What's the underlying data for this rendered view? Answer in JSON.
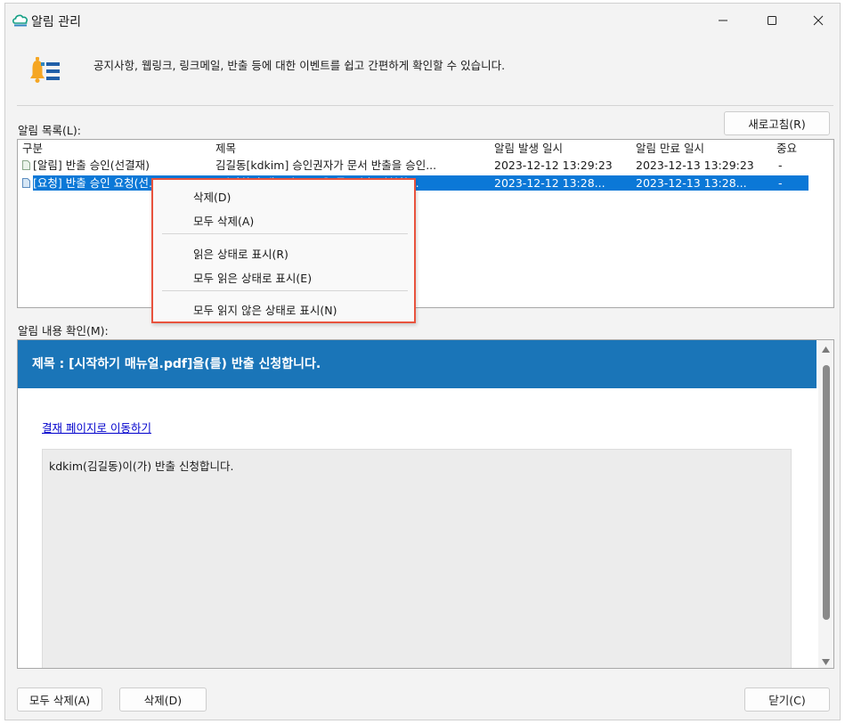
{
  "window": {
    "title": "알림 관리",
    "icons": {
      "app": "cloud-logo-icon",
      "minimize": "minimize-icon",
      "maximize": "maximize-icon",
      "close": "close-icon"
    }
  },
  "header": {
    "icon": "bell-list-icon",
    "description": "공지사항, 웹링크, 링크메일, 반출 등에 대한 이벤트를 쉽고 간편하게 확인할 수 있습니다."
  },
  "list": {
    "label": "알림 목록(L):",
    "refresh_label": "새로고침(R)",
    "columns": [
      "구분",
      "제목",
      "알림 발생 일시",
      "알림 만료 일시",
      "중요"
    ],
    "rows": [
      {
        "category": "[알림] 반출 승인(선결재)",
        "title": "김길동[kdkim] 승인권자가 문서 반출을 승인...",
        "created": "2023-12-12 13:29:23",
        "expires": "2023-12-13 13:29:23",
        "important": "-",
        "selected": false
      },
      {
        "category": "[요청] 반출 승인 요청(선...",
        "title": "[시작하기 매뉴얼.pdf]을(를) 반출 신청합...",
        "created": "2023-12-12 13:28...",
        "expires": "2023-12-13 13:28...",
        "important": "-",
        "selected": true
      }
    ]
  },
  "context_menu": {
    "items": [
      {
        "label": "삭제(D)"
      },
      {
        "label": "모두 삭제(A)"
      },
      {
        "label": "읽은 상태로 표시(R)"
      },
      {
        "label": "모두 읽은 상태로 표시(E)"
      },
      {
        "label": "모두 읽지 않은 상태로 표시(N)"
      }
    ]
  },
  "detail": {
    "label": "알림 내용 확인(M):",
    "title": "제목 : [시작하기 매뉴얼.pdf]을(를) 반출 신청합니다.",
    "link": "결재 페이지로 이동하기",
    "body": "kdkim(김길동)이(가) 반출 신청합니다."
  },
  "footer": {
    "delete_all_label": "모두 삭제(A)",
    "delete_label": "삭제(D)",
    "close_label": "닫기(C)"
  },
  "colors": {
    "accent": "#0b78d7",
    "detail_header": "#1a75b8",
    "menu_border": "#e8533e",
    "link": "#0000cc"
  }
}
